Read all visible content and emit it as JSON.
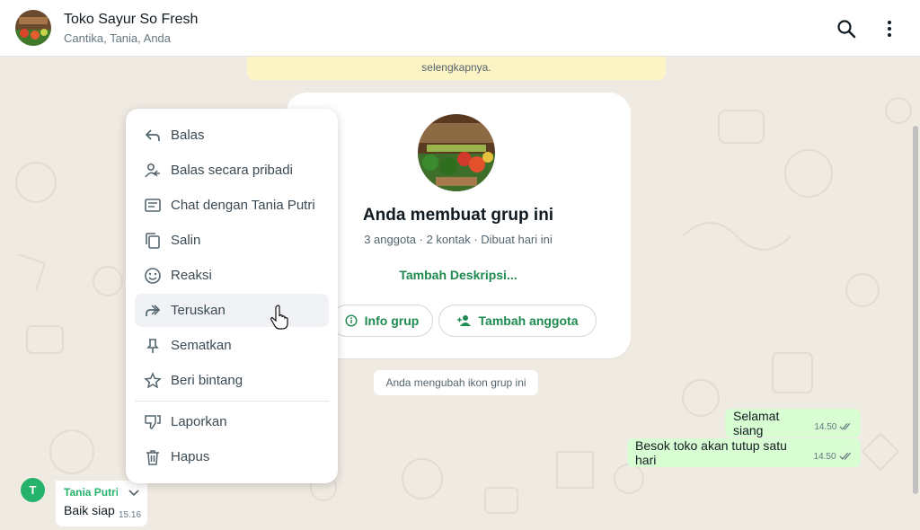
{
  "header": {
    "title": "Toko Sayur So Fresh",
    "subtitle": "Cantika, Tania, Anda",
    "search_icon": "search-icon",
    "menu_icon": "more-vertical-icon"
  },
  "banner": {
    "text": "selengkapnya."
  },
  "group_card": {
    "title": "Anda membuat grup ini",
    "meta": "3 anggota · 2 kontak · Dibuat hari ini",
    "add_description": "Tambah Deskripsi...",
    "info_button": "Info grup",
    "add_member_button": "Tambah anggota"
  },
  "system_message": "Anda mengubah ikon grup ini",
  "outgoing_messages": [
    {
      "text": "Selamat siang",
      "time": "14.50"
    },
    {
      "text": "Besok toko akan tutup satu hari",
      "time": "14.50"
    }
  ],
  "incoming_message": {
    "avatar_initial": "T",
    "sender": "Tania Putri",
    "text": "Baik siap",
    "time": "15.16"
  },
  "context_menu": {
    "items": [
      {
        "label": "Balas",
        "icon": "reply-icon"
      },
      {
        "label": "Balas secara pribadi",
        "icon": "reply-private-icon"
      },
      {
        "label": "Chat dengan Tania Putri",
        "icon": "message-icon"
      },
      {
        "label": "Salin",
        "icon": "copy-icon"
      },
      {
        "label": "Reaksi",
        "icon": "emoji-icon"
      },
      {
        "label": "Teruskan",
        "icon": "forward-icon"
      },
      {
        "label": "Sematkan",
        "icon": "pin-icon"
      },
      {
        "label": "Beri bintang",
        "icon": "star-icon"
      },
      {
        "label": "Laporkan",
        "icon": "thumbs-down-icon"
      },
      {
        "label": "Hapus",
        "icon": "trash-icon"
      }
    ]
  },
  "colors": {
    "accent": "#1e8a50",
    "outgoing_bubble": "#d9fdd3",
    "chat_bg": "#efeae2"
  }
}
